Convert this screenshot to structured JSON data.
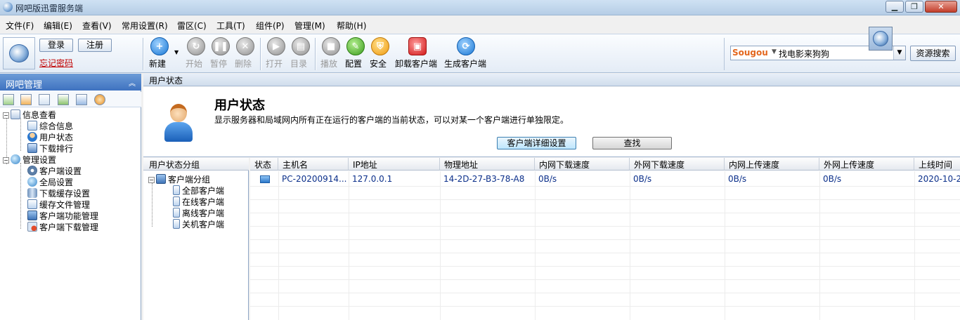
{
  "window": {
    "title": "网吧版迅雷服务端",
    "min": "▁",
    "max": "❐",
    "close": "✕"
  },
  "menu": [
    "文件(F)",
    "编辑(E)",
    "查看(V)",
    "常用设置(R)",
    "雷区(C)",
    "工具(T)",
    "组件(P)",
    "管理(M)",
    "帮助(H)"
  ],
  "account": {
    "login": "登录",
    "register": "注册",
    "forgot": "忘记密码"
  },
  "toolbar": {
    "new": "新建",
    "start": "开始",
    "pause": "暂停",
    "delete": "删除",
    "open": "打开",
    "folder": "目录",
    "play": "播放",
    "config": "配置",
    "security": "安全",
    "uninstall": "卸载客户端",
    "generate": "生成客户端"
  },
  "search": {
    "engine": "Sougou",
    "value": "找电影来狗狗",
    "button": "资源搜索"
  },
  "sidebar": {
    "title": "网吧管理",
    "tree": {
      "info": "信息查看",
      "summary": "综合信息",
      "user_status": "用户状态",
      "download_rank": "下载排行",
      "manage": "管理设置",
      "client_settings": "客户端设置",
      "global_settings": "全局设置",
      "cache_settings": "下载缓存设置",
      "cache_files": "缓存文件管理",
      "client_func": "客户端功能管理",
      "client_download": "客户端下载管理"
    }
  },
  "content": {
    "breadcrumb": "用户状态",
    "title": "用户状态",
    "description": "显示服务器和局域网内所有正在运行的客户端的当前状态，可以对某一个客户端进行单独限定。",
    "detail_button": "客户端详细设置",
    "find_button": "查找"
  },
  "groups": {
    "header": "用户状态分组",
    "root": "客户端分组",
    "items": [
      "全部客户端",
      "在线客户端",
      "离线客户端",
      "关机客户端"
    ]
  },
  "table": {
    "columns": [
      "状态",
      "主机名",
      "IP地址",
      "物理地址",
      "内网下载速度",
      "外网下载速度",
      "内网上传速度",
      "外网上传速度",
      "上线时间"
    ],
    "rows": [
      {
        "host": "PC-20200914...",
        "ip": "127.0.0.1",
        "mac": "14-2D-27-B3-78-A8",
        "lan_down": "0B/s",
        "wan_down": "0B/s",
        "lan_up": "0B/s",
        "wan_up": "0B/s",
        "online": "2020-10-2"
      }
    ]
  }
}
